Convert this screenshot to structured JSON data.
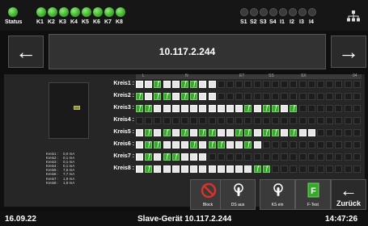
{
  "status_bar": {
    "status_label": "Status",
    "relay_labels": [
      "K1",
      "K2",
      "K3",
      "K4",
      "K5",
      "K6",
      "K7",
      "K8"
    ],
    "input_labels": [
      "S1",
      "S2",
      "S3",
      "S4",
      "I1",
      "I2",
      "I3",
      "I4"
    ]
  },
  "nav": {
    "title": "10.117.2.244",
    "prev_arrow": "←",
    "next_arrow": "→"
  },
  "kreise": {
    "labels": [
      "Kreis1 :",
      "Kreis2 :",
      "Kreis3 :",
      "Kreis4 :",
      "Kreis5 :",
      "Kreis6 :",
      "Kreis7 :",
      "Kreis8 :"
    ],
    "header_ticks": [
      "L",
      "N",
      "ET",
      "SS",
      "SX",
      "04"
    ]
  },
  "legend": [
    {
      "name": "Kreis1 :",
      "value": "0,0 mA"
    },
    {
      "name": "Kreis2 :",
      "value": "0,1 mA"
    },
    {
      "name": "Kreis3 :",
      "value": "0,1 mA"
    },
    {
      "name": "Kreis4 :",
      "value": "0,1 mA"
    },
    {
      "name": "Kreis5 :",
      "value": "7,5 mA"
    },
    {
      "name": "Kreis6 :",
      "value": "7,7 mA"
    },
    {
      "name": "Kreis7 :",
      "value": "1,9 mA"
    },
    {
      "name": "Kreis8 :",
      "value": "1,9 mA"
    }
  ],
  "actions": {
    "block": "Block",
    "ds_aus": "DS aus",
    "ks_ein": "KS ein",
    "f_test": "F-Test",
    "back_label": "Zurück",
    "back_arrow": "←"
  },
  "footer": {
    "date": "16.09.22",
    "device": "Slave-Gerät 10.117.2.244",
    "time": "14:47:26"
  },
  "colors": {
    "led_on": "#3fae2a",
    "cell_green": "#36a82a",
    "block_red": "#d9322a"
  }
}
